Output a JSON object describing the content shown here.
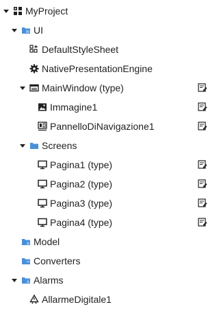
{
  "tree": {
    "nodes": [
      {
        "label": "MyProject",
        "icon": "project-grid-icon"
      },
      {
        "label": "UI",
        "icon": "folder-ui-icon"
      },
      {
        "label": "DefaultStyleSheet",
        "icon": "stylesheet-icon"
      },
      {
        "label": "NativePresentationEngine",
        "icon": "gear-icon"
      },
      {
        "label": "MainWindow (type)",
        "icon": "window-icon"
      },
      {
        "label": "Immagine1",
        "icon": "image-icon"
      },
      {
        "label": "PannelloDiNavigazione1",
        "icon": "navigation-panel-icon"
      },
      {
        "label": "Screens",
        "icon": "folder-screens-icon"
      },
      {
        "label": "Pagina1 (type)",
        "icon": "monitor-icon"
      },
      {
        "label": "Pagina2 (type)",
        "icon": "monitor-icon"
      },
      {
        "label": "Pagina3 (type)",
        "icon": "monitor-icon"
      },
      {
        "label": "Pagina4 (type)",
        "icon": "monitor-icon"
      },
      {
        "label": "Model",
        "icon": "folder-model-icon"
      },
      {
        "label": "Converters",
        "icon": "folder-converters-icon"
      },
      {
        "label": "Alarms",
        "icon": "folder-alarms-icon"
      },
      {
        "label": "AllarmeDigitale1",
        "icon": "alarm-icon"
      }
    ],
    "type_action_icon": "edit-type-icon"
  },
  "colors": {
    "text": "#1f1f1f",
    "icon_dark": "#222222",
    "folder_blue": "#4a90d9",
    "folder_light": "#8fbbe8"
  }
}
